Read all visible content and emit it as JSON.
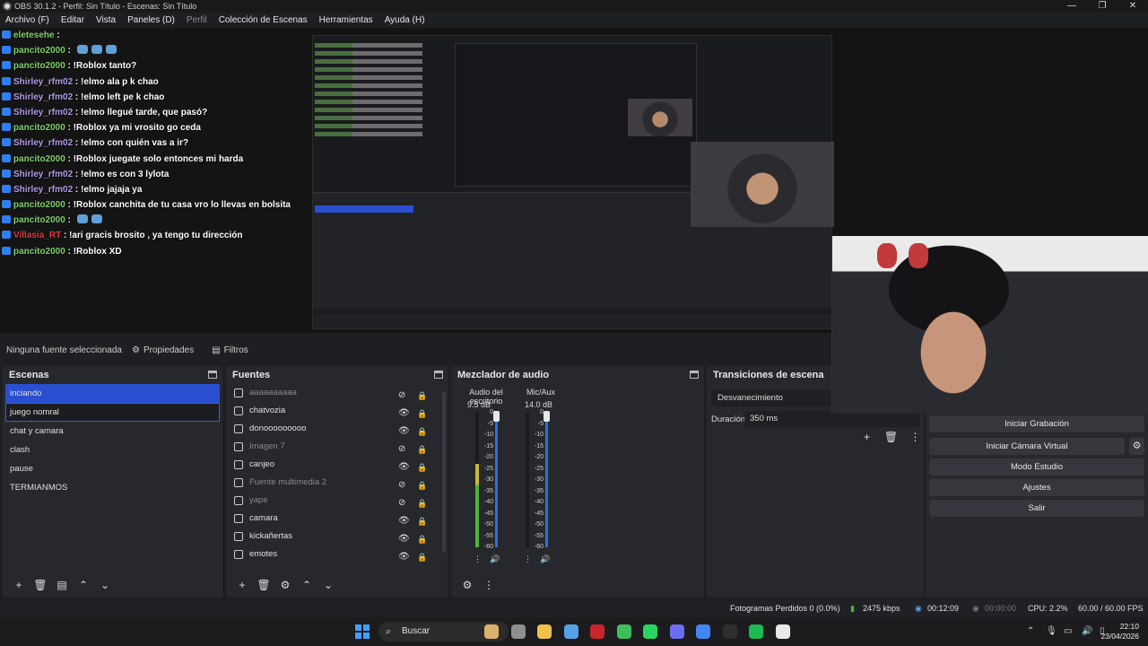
{
  "window": {
    "title": "OBS 30.1.2 - Perfil: Sin Título - Escenas: Sin Título",
    "controls": [
      "—",
      "❐",
      "✕"
    ]
  },
  "menu": [
    {
      "label": "Archivo (F)",
      "enabled": true
    },
    {
      "label": "Editar",
      "enabled": true
    },
    {
      "label": "Vista",
      "enabled": true
    },
    {
      "label": "Paneles (D)",
      "enabled": true
    },
    {
      "label": "Perfil",
      "enabled": false
    },
    {
      "label": "Colección de Escenas",
      "enabled": true
    },
    {
      "label": "Herramientas",
      "enabled": true
    },
    {
      "label": "Ayuda (H)",
      "enabled": true
    }
  ],
  "chat": [
    {
      "user": "eletesehe",
      "msg": "",
      "color": "pancito"
    },
    {
      "user": "pancito2000",
      "msg": "",
      "color": "pancito",
      "emotes": 3
    },
    {
      "user": "pancito2000",
      "msg": "!Roblox tanto?",
      "color": "pancito"
    },
    {
      "user": "Shirley_rfm02",
      "msg": "!elmo ala p k chao",
      "color": "shirley"
    },
    {
      "user": "Shirley_rfm02",
      "msg": "!elmo left pe k chao",
      "color": "shirley"
    },
    {
      "user": "Shirley_rfm02",
      "msg": "!elmo llegué tarde, que pasó?",
      "color": "shirley"
    },
    {
      "user": "pancito2000",
      "msg": "!Roblox ya mi vrosito go ceda",
      "color": "pancito"
    },
    {
      "user": "Shirley_rfm02",
      "msg": "!elmo con quién vas a ir?",
      "color": "shirley"
    },
    {
      "user": "pancito2000",
      "msg": "!Roblox juegate solo entonces mi harda",
      "color": "pancito"
    },
    {
      "user": "Shirley_rfm02",
      "msg": "!elmo es con 3 lylota",
      "color": "shirley"
    },
    {
      "user": "Shirley_rfm02",
      "msg": "!elmo jajaja ya",
      "color": "shirley"
    },
    {
      "user": "pancito2000",
      "msg": "!Roblox canchita de tu casa vro lo llevas en bolsita",
      "color": "pancito"
    },
    {
      "user": "pancito2000",
      "msg": "",
      "color": "pancito",
      "emotes": 2
    },
    {
      "user": "Villasia_RT",
      "msg": "!ari gracis brosito , ya tengo tu dirección",
      "color": "villasia"
    },
    {
      "user": "pancito2000",
      "msg": "!Roblox XD",
      "color": "pancito"
    }
  ],
  "source_toolbar": {
    "none_selected": "Ninguna fuente seleccionada",
    "properties": "Propiedades",
    "filters": "Filtros"
  },
  "scenes": {
    "title": "Escenas",
    "items": [
      {
        "label": "inciando",
        "state": "active"
      },
      {
        "label": "juego nomral",
        "state": "editing"
      },
      {
        "label": "chat y camara",
        "state": "normal"
      },
      {
        "label": "clash",
        "state": "normal"
      },
      {
        "label": "pause",
        "state": "normal"
      },
      {
        "label": "TERMIANMOS",
        "state": "normal"
      }
    ],
    "footer": [
      "+",
      "🗑",
      "▤",
      "⌃",
      "⌄"
    ]
  },
  "sources": {
    "title": "Fuentes",
    "items": [
      {
        "label": "aaaaaaaaaa",
        "visible": false,
        "icon": "image"
      },
      {
        "label": "chatvozia",
        "visible": true,
        "icon": "browser"
      },
      {
        "label": "donooooooooo",
        "visible": true,
        "icon": "browser"
      },
      {
        "label": "Imagen 7",
        "visible": false,
        "icon": "image"
      },
      {
        "label": "canjeo",
        "visible": true,
        "icon": "browser"
      },
      {
        "label": "Fuente multimedia 2",
        "visible": false,
        "icon": "media"
      },
      {
        "label": "yape",
        "visible": false,
        "icon": "image"
      },
      {
        "label": "camara",
        "visible": true,
        "icon": "camera"
      },
      {
        "label": "kickañertas",
        "visible": true,
        "icon": "browser"
      },
      {
        "label": "emotes",
        "visible": true,
        "icon": "browser"
      }
    ],
    "footer": [
      "+",
      "🗑",
      "⚙",
      "⌃",
      "⌄"
    ]
  },
  "mixer": {
    "title": "Mezclador de audio",
    "channels": [
      {
        "name": "Audio del escritorio",
        "db": "9.5 dB",
        "level": 0.62
      },
      {
        "name": "Mic/Aux",
        "db": "14.0 dB",
        "level": 0.0
      }
    ],
    "scale": [
      "0",
      "-5",
      "-10",
      "-15",
      "-20",
      "-25",
      "-30",
      "-35",
      "-40",
      "-45",
      "-50",
      "-55",
      "-60"
    ]
  },
  "transitions": {
    "title": "Transiciones de escena",
    "selected": "Desvanecimiento",
    "duration_label": "Duración",
    "duration_value": "350 ms"
  },
  "controls": {
    "buttons": [
      "Iniciar Grabación",
      "Iniciar Cámara Virtual",
      "Modo Estudio",
      "Ajustes",
      "Salir"
    ]
  },
  "status": {
    "dropped": "Fotogramas Perdidos 0 (0.0%)",
    "bitrate": "2475 kbps",
    "stream_time": "00:12:09",
    "rec_time": "00:00:00",
    "cpu": "CPU: 2.2%",
    "fps": "60.00 / 60.00 FPS"
  },
  "taskbar": {
    "search": "Buscar",
    "time": "22:10",
    "date": "23/04/2026",
    "apps": [
      "#d9b36a",
      "#8f8f8f",
      "#f0c24b",
      "#55a1e8",
      "#c8262b",
      "#3fbf5b",
      "#2bd45f",
      "#6b6ef0",
      "#4285f4",
      "#2e2e2e",
      "#1db954",
      "#e8e8e8"
    ]
  },
  "colors": {
    "accent": "#2a4fd0",
    "meter_green": "#4fb33a",
    "meter_yellow": "#c9b837"
  }
}
